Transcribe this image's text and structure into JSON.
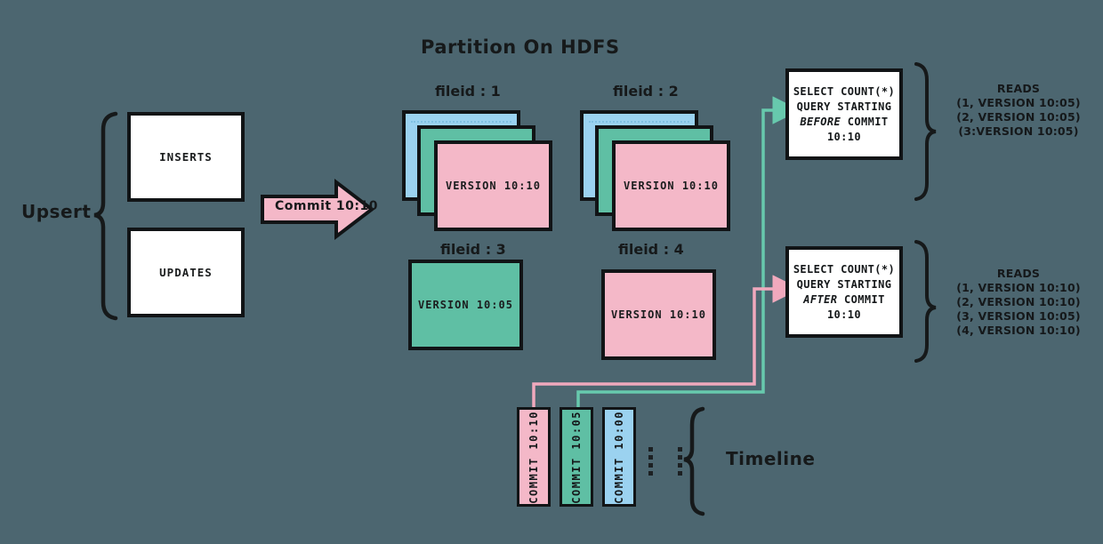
{
  "diagram": {
    "title": "Partition On HDFS",
    "upsert_label": "Upsert",
    "timeline_label": "Timeline"
  },
  "colors": {
    "background": "#4c6670",
    "pink": "#f4b8c8",
    "teal": "#5fbfa4",
    "blue": "#9bd2f0",
    "white": "#ffffff",
    "stroke": "#111416",
    "wire_pink": "#f0a9bd",
    "wire_teal": "#67c9ad"
  },
  "upsert": {
    "label": "Upsert",
    "boxes": [
      {
        "label": "INSERTS"
      },
      {
        "label": "UPDATES"
      }
    ]
  },
  "commit_arrow": {
    "label": "Commit 10:10"
  },
  "partition": {
    "title": "Partition On HDFS",
    "files": [
      {
        "label": "fileid : 1",
        "stacked": true,
        "layers": [
          "blue",
          "teal",
          "pink"
        ],
        "front_text": "VERSION 10:10"
      },
      {
        "label": "fileid : 2",
        "stacked": true,
        "layers": [
          "blue",
          "teal",
          "pink"
        ],
        "front_text": "VERSION 10:10"
      },
      {
        "label": "fileid : 3",
        "stacked": false,
        "color": "teal",
        "front_text": "VERSION 10:05"
      },
      {
        "label": "fileid : 4",
        "stacked": false,
        "color": "pink",
        "front_text": "VERSION 10:10"
      }
    ]
  },
  "queries": [
    {
      "id": "before",
      "lines": [
        "SELECT COUNT(*)",
        "QUERY STARTING",
        "BEFORE COMMIT",
        "10:10"
      ],
      "line1": "SELECT COUNT(*)",
      "line2": "QUERY STARTING",
      "keyword": "BEFORE",
      "line3_rest": " COMMIT",
      "line4": "10:10",
      "wire_color": "#67c9ad"
    },
    {
      "id": "after",
      "lines": [
        "SELECT COUNT(*)",
        "QUERY STARTING",
        "AFTER COMMIT",
        "10:10"
      ],
      "line1": "SELECT COUNT(*)",
      "line2": "QUERY STARTING",
      "keyword": "AFTER",
      "line3_rest": " COMMIT",
      "line4": "10:10",
      "wire_color": "#f0a9bd"
    }
  ],
  "reads": [
    {
      "heading": "READS",
      "rows": [
        "(1, VERSION 10:05)",
        "(2, VERSION 10:05)",
        "(3:VERSION 10:05)"
      ]
    },
    {
      "heading": "READS",
      "rows": [
        "(1, VERSION 10:10)",
        "(2, VERSION 10:10)",
        "(3, VERSION 10:05)",
        "(4, VERSION 10:10)"
      ]
    }
  ],
  "timeline": {
    "label": "Timeline",
    "commits": [
      {
        "label": "COMMIT  10:10",
        "color": "pink"
      },
      {
        "label": "COMMIT  10:05",
        "color": "teal"
      },
      {
        "label": "COMMIT  10:00",
        "color": "blue"
      }
    ],
    "ellipsis_groups": 2
  }
}
